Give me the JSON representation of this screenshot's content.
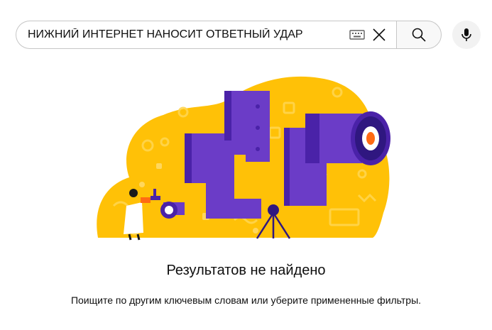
{
  "search": {
    "query": "НИЖНИЙ ИНТЕРНЕТ НАНОСИТ ОТВЕТНЫЙ УДАР"
  },
  "icons": {
    "keyboard": "keyboard-icon",
    "clear": "close-icon",
    "search": "search-icon",
    "mic": "microphone-icon"
  },
  "empty_state": {
    "title": "Результатов не найдено",
    "hint": "Поищите по другим ключевым словам или уберите примененные фильтры."
  },
  "colors": {
    "blob": "#ffc107",
    "purple": "#6b3cc7",
    "purple_dark": "#4a22a8",
    "accent": "#ff6a13"
  }
}
